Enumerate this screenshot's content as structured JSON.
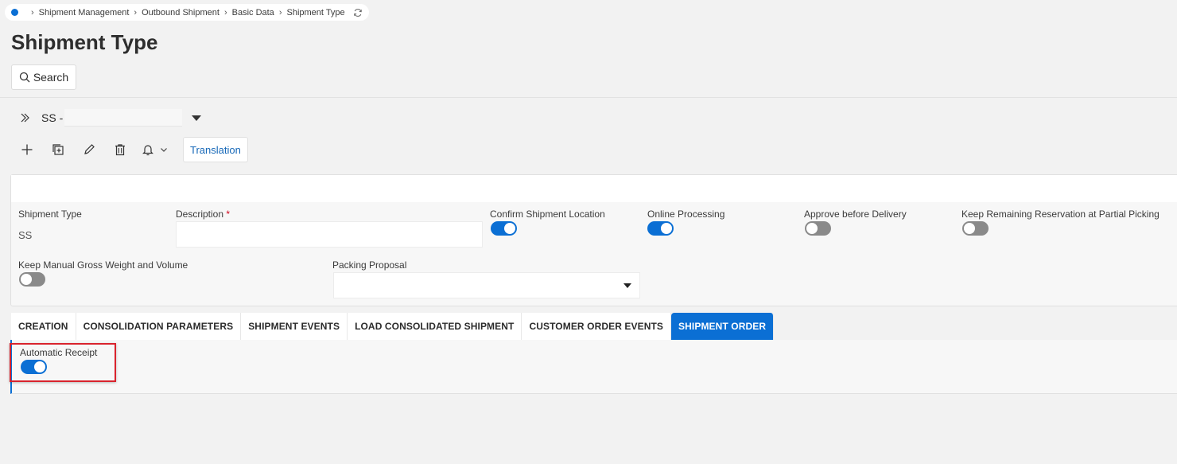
{
  "breadcrumb": {
    "items": [
      "Shipment Management",
      "Outbound Shipment",
      "Basic Data",
      "Shipment Type"
    ]
  },
  "page": {
    "title": "Shipment Type",
    "search_label": "Search"
  },
  "record": {
    "id_label": "SS -",
    "description": ""
  },
  "toolbar": {
    "translation_label": "Translation"
  },
  "form": {
    "shipment_type": {
      "label": "Shipment Type",
      "value": "SS"
    },
    "description": {
      "label": "Description",
      "required_mark": "*",
      "value": ""
    },
    "confirm_shipment_location": {
      "label": "Confirm Shipment Location",
      "on": true
    },
    "online_processing": {
      "label": "Online Processing",
      "on": true
    },
    "approve_before_delivery": {
      "label": "Approve before Delivery",
      "on": false
    },
    "keep_remaining_reservation": {
      "label": "Keep Remaining Reservation at Partial Picking",
      "on": false
    },
    "keep_manual_gross_weight": {
      "label": "Keep Manual Gross Weight and Volume",
      "on": false
    },
    "packing_proposal": {
      "label": "Packing Proposal",
      "value": ""
    }
  },
  "tabs": [
    {
      "label": "CREATION",
      "active": false
    },
    {
      "label": "CONSOLIDATION PARAMETERS",
      "active": false
    },
    {
      "label": "SHIPMENT EVENTS",
      "active": false
    },
    {
      "label": "LOAD CONSOLIDATED SHIPMENT",
      "active": false
    },
    {
      "label": "CUSTOMER ORDER EVENTS",
      "active": false
    },
    {
      "label": "SHIPMENT ORDER",
      "active": true
    }
  ],
  "shipment_order": {
    "automatic_receipt": {
      "label": "Automatic Receipt",
      "on": true
    }
  },
  "colors": {
    "accent": "#0b6fd4",
    "highlight": "#d9232d",
    "toggle_off": "#8a8a8a"
  }
}
